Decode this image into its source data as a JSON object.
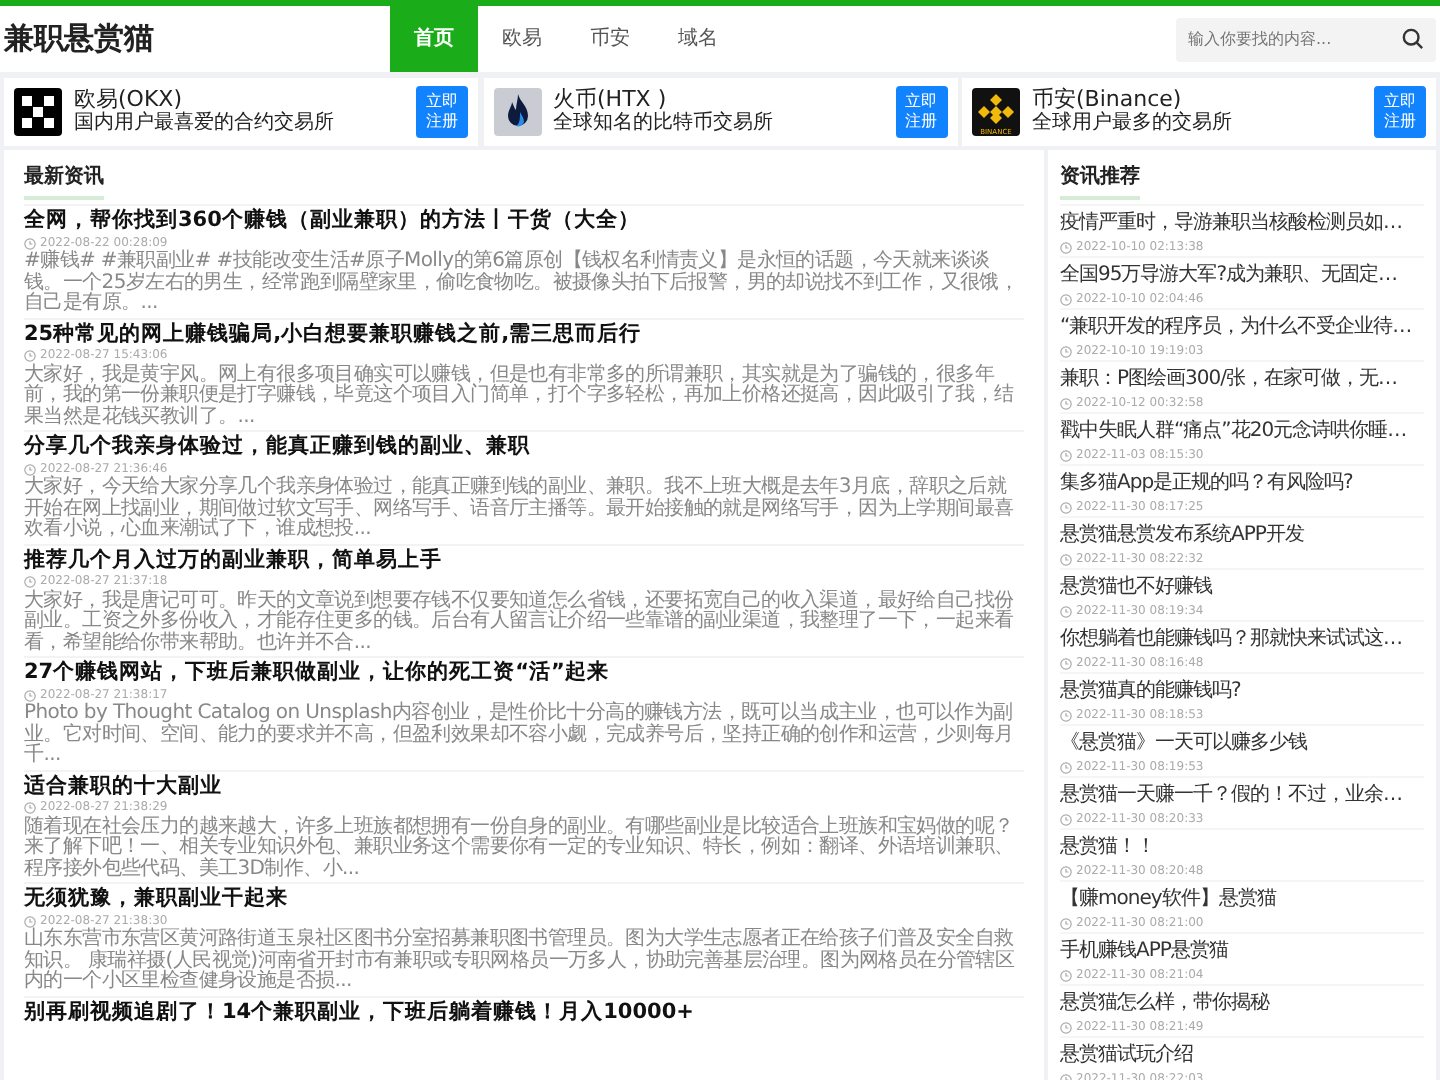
{
  "site": {
    "logo": "兼职悬赏猫"
  },
  "nav": [
    {
      "label": "首页",
      "selected": true
    },
    {
      "label": "欧易",
      "selected": false
    },
    {
      "label": "币安",
      "selected": false
    },
    {
      "label": "域名",
      "selected": false
    }
  ],
  "search": {
    "placeholder": "输入你要找的内容..."
  },
  "exchanges": [
    {
      "kind": "okx",
      "name": "欧易(OKX)",
      "desc": "国内用户最喜爱的合约交易所",
      "button": "立即注册"
    },
    {
      "kind": "htx",
      "name": "火币(HTX )",
      "desc": "全球知名的比特币交易所",
      "button": "立即注册"
    },
    {
      "kind": "binance",
      "name": "币安(Binance)",
      "desc": "全球用户最多的交易所",
      "button": "立即注册",
      "logo_text": "BINANCE"
    }
  ],
  "latest": {
    "title": "最新资讯",
    "articles": [
      {
        "title": "全网，帮你找到360个赚钱（副业兼职）的方法丨干货（大全）",
        "date": "2022-08-22 00:28:09",
        "excerpt": "#赚钱# #兼职副业# #技能改变生活#原子Molly的第6篇原创【钱权名利情责义】是永恒的话题，今天就来谈谈钱。一个25岁左右的男生，经常跑到隔壁家里，偷吃食物吃。被摄像头拍下后报警，男的却说找不到工作，又很饿，自己是有原。..."
      },
      {
        "title": "25种常见的网上赚钱骗局,小白想要兼职赚钱之前,需三思而后行",
        "date": "2022-08-27 15:43:06",
        "excerpt": "大家好，我是黄宇风。网上有很多项目确实可以赚钱，但是也有非常多的所谓兼职，其实就是为了骗钱的，很多年前，我的第一份兼职便是打字赚钱，毕竟这个项目入门简单，打个字多轻松，再加上价格还挺高，因此吸引了我，结果当然是花钱买教训了。..."
      },
      {
        "title": "分享几个我亲身体验过，能真正赚到钱的副业、兼职",
        "date": "2022-08-27 21:36:46",
        "excerpt": "大家好，今天给大家分享几个我亲身体验过，能真正赚到钱的副业、兼职。我不上班大概是去年3月底，辞职之后就开始在网上找副业，期间做过软文写手、网络写手、语音厅主播等。最开始接触的就是网络写手，因为上学期间最喜欢看小说，心血来潮试了下，谁成想投..."
      },
      {
        "title": "推荐几个月入过万的副业兼职，简单易上手",
        "date": "2022-08-27 21:37:18",
        "excerpt": "大家好，我是唐记可可。昨天的文章说到想要存钱不仅要知道怎么省钱，还要拓宽自己的收入渠道，最好给自己找份副业。工资之外多份收入，才能存住更多的钱。后台有人留言让介绍一些靠谱的副业渠道，我整理了一下，一起来看看，希望能给你带来帮助。也许并不合..."
      },
      {
        "title": "27个赚钱网站，下班后兼职做副业，让你的死工资“活”起来",
        "date": "2022-08-27 21:38:17",
        "excerpt": "Photo by Thought Catalog on Unsplash内容创业，是性价比十分高的赚钱方法，既可以当成主业，也可以作为副业。它对时间、空间、能力的要求并不高，但盈利效果却不容小觑，完成养号后，坚持正确的创作和运营，少则每月千..."
      },
      {
        "title": "适合兼职的十大副业",
        "date": "2022-08-27 21:38:29",
        "excerpt": "随着现在社会压力的越来越大，许多上班族都想拥有一份自身的副业。有哪些副业是比较适合上班族和宝妈做的呢？来了解下吧！一、相关专业知识外包、兼职业务这个需要你有一定的专业知识、特长，例如：翻译、外语培训兼职、程序接外包些代码、美工3D制作、小..."
      },
      {
        "title": "无须犹豫，兼职副业干起来",
        "date": "2022-08-27 21:38:30",
        "excerpt": "山东东营市东营区黄河路街道玉泉社区图书分室招募兼职图书管理员。图为大学生志愿者正在给孩子们普及安全自救知识。 康瑞祥摄(人民视觉)河南省开封市有兼职或专职网格员一万多人，协助完善基层治理。图为网格员在分管辖区内的一个小区里检查健身设施是否损..."
      },
      {
        "title": "别再刷视频追剧了！14个兼职副业，下班后躺着赚钱！月入10000+"
      }
    ]
  },
  "recommend": {
    "title": "资讯推荐",
    "items": [
      {
        "title": "疫情严重时，导游兼职当核酸检测员如…",
        "date": "2022-10-10 02:13:38"
      },
      {
        "title": "全国95万导游大军?成为兼职、无固定…",
        "date": "2022-10-10 02:04:46"
      },
      {
        "title": "“兼职开发的程序员，为什么不受企业待…",
        "date": "2022-10-10 19:19:03"
      },
      {
        "title": "兼职：P图绘画300/张，在家可做，无…",
        "date": "2022-10-12 00:32:58"
      },
      {
        "title": "戳中失眠人群“痛点”花20元念诗哄你睡…",
        "date": "2022-11-03 08:15:30"
      },
      {
        "title": "集多猫App是正规的吗？有风险吗?",
        "date": "2022-11-30 08:17:25"
      },
      {
        "title": "悬赏猫悬赏发布系统APP开发",
        "date": "2022-11-30 08:22:32"
      },
      {
        "title": "悬赏猫也不好赚钱",
        "date": "2022-11-30 08:19:34"
      },
      {
        "title": "你想躺着也能赚钱吗？那就快来试试这…",
        "date": "2022-11-30 08:16:48"
      },
      {
        "title": "悬赏猫真的能赚钱吗?",
        "date": "2022-11-30 08:18:53"
      },
      {
        "title": "《悬赏猫》一天可以赚多少钱",
        "date": "2022-11-30 08:19:53"
      },
      {
        "title": "悬赏猫一天赚一千？假的！不过，业余…",
        "date": "2022-11-30 08:20:33"
      },
      {
        "title": "悬赏猫！！",
        "date": "2022-11-30 08:20:48"
      },
      {
        "title": "【赚money软件】悬赏猫",
        "date": "2022-11-30 08:21:00"
      },
      {
        "title": "手机赚钱APP悬赏猫",
        "date": "2022-11-30 08:21:04"
      },
      {
        "title": "悬赏猫怎么样，带你揭秘",
        "date": "2022-11-30 08:21:49"
      },
      {
        "title": "悬赏猫试玩介绍",
        "date": "2022-11-30 08:22:03"
      }
    ]
  }
}
